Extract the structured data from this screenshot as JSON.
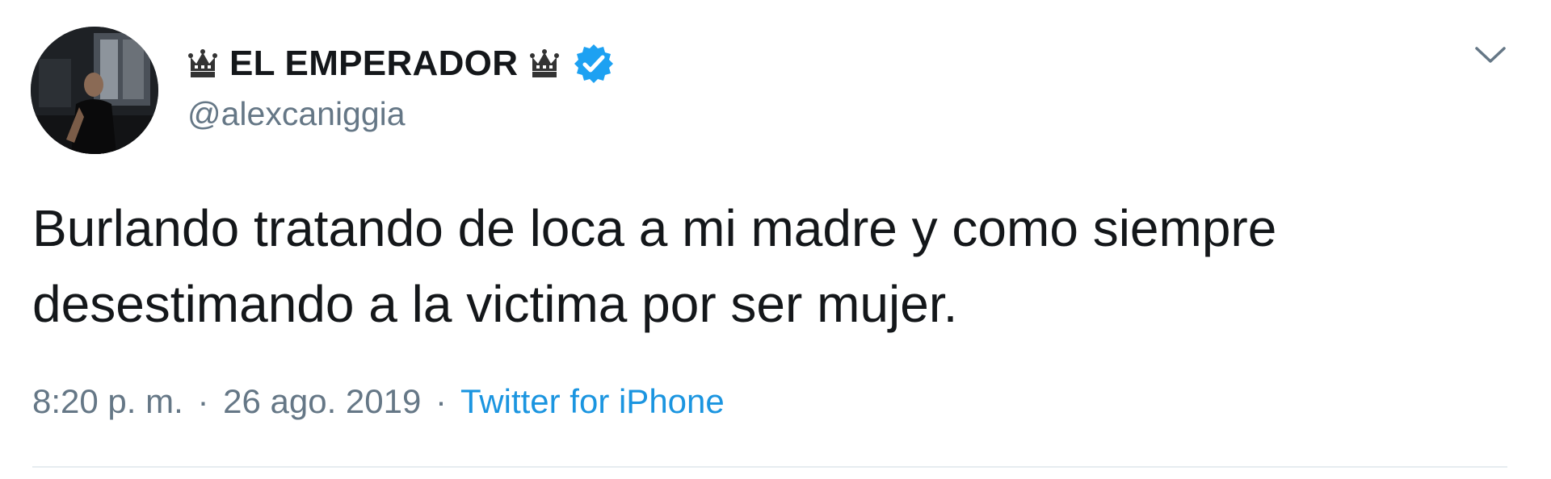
{
  "tweet": {
    "display_name": "EL EMPERADOR",
    "handle": "@alexcaniggia",
    "text_line1": "Burlando tratando de loca a mi madre y como siempre",
    "text_line2": "desestimando a la victima por ser mujer.",
    "time": "8:20 p. m.",
    "separator": "·",
    "date": "26 ago. 2019",
    "source": "Twitter for iPhone"
  },
  "icons": {
    "left_emoji": "crown-icon",
    "right_emoji": "crown-icon",
    "badge": "verified-badge-icon",
    "menu": "chevron-down-icon"
  },
  "colors": {
    "text": "#14171a",
    "secondary": "#657786",
    "link": "#1b95e0",
    "verified": "#1da1f2",
    "divider": "#e6ecf0"
  }
}
